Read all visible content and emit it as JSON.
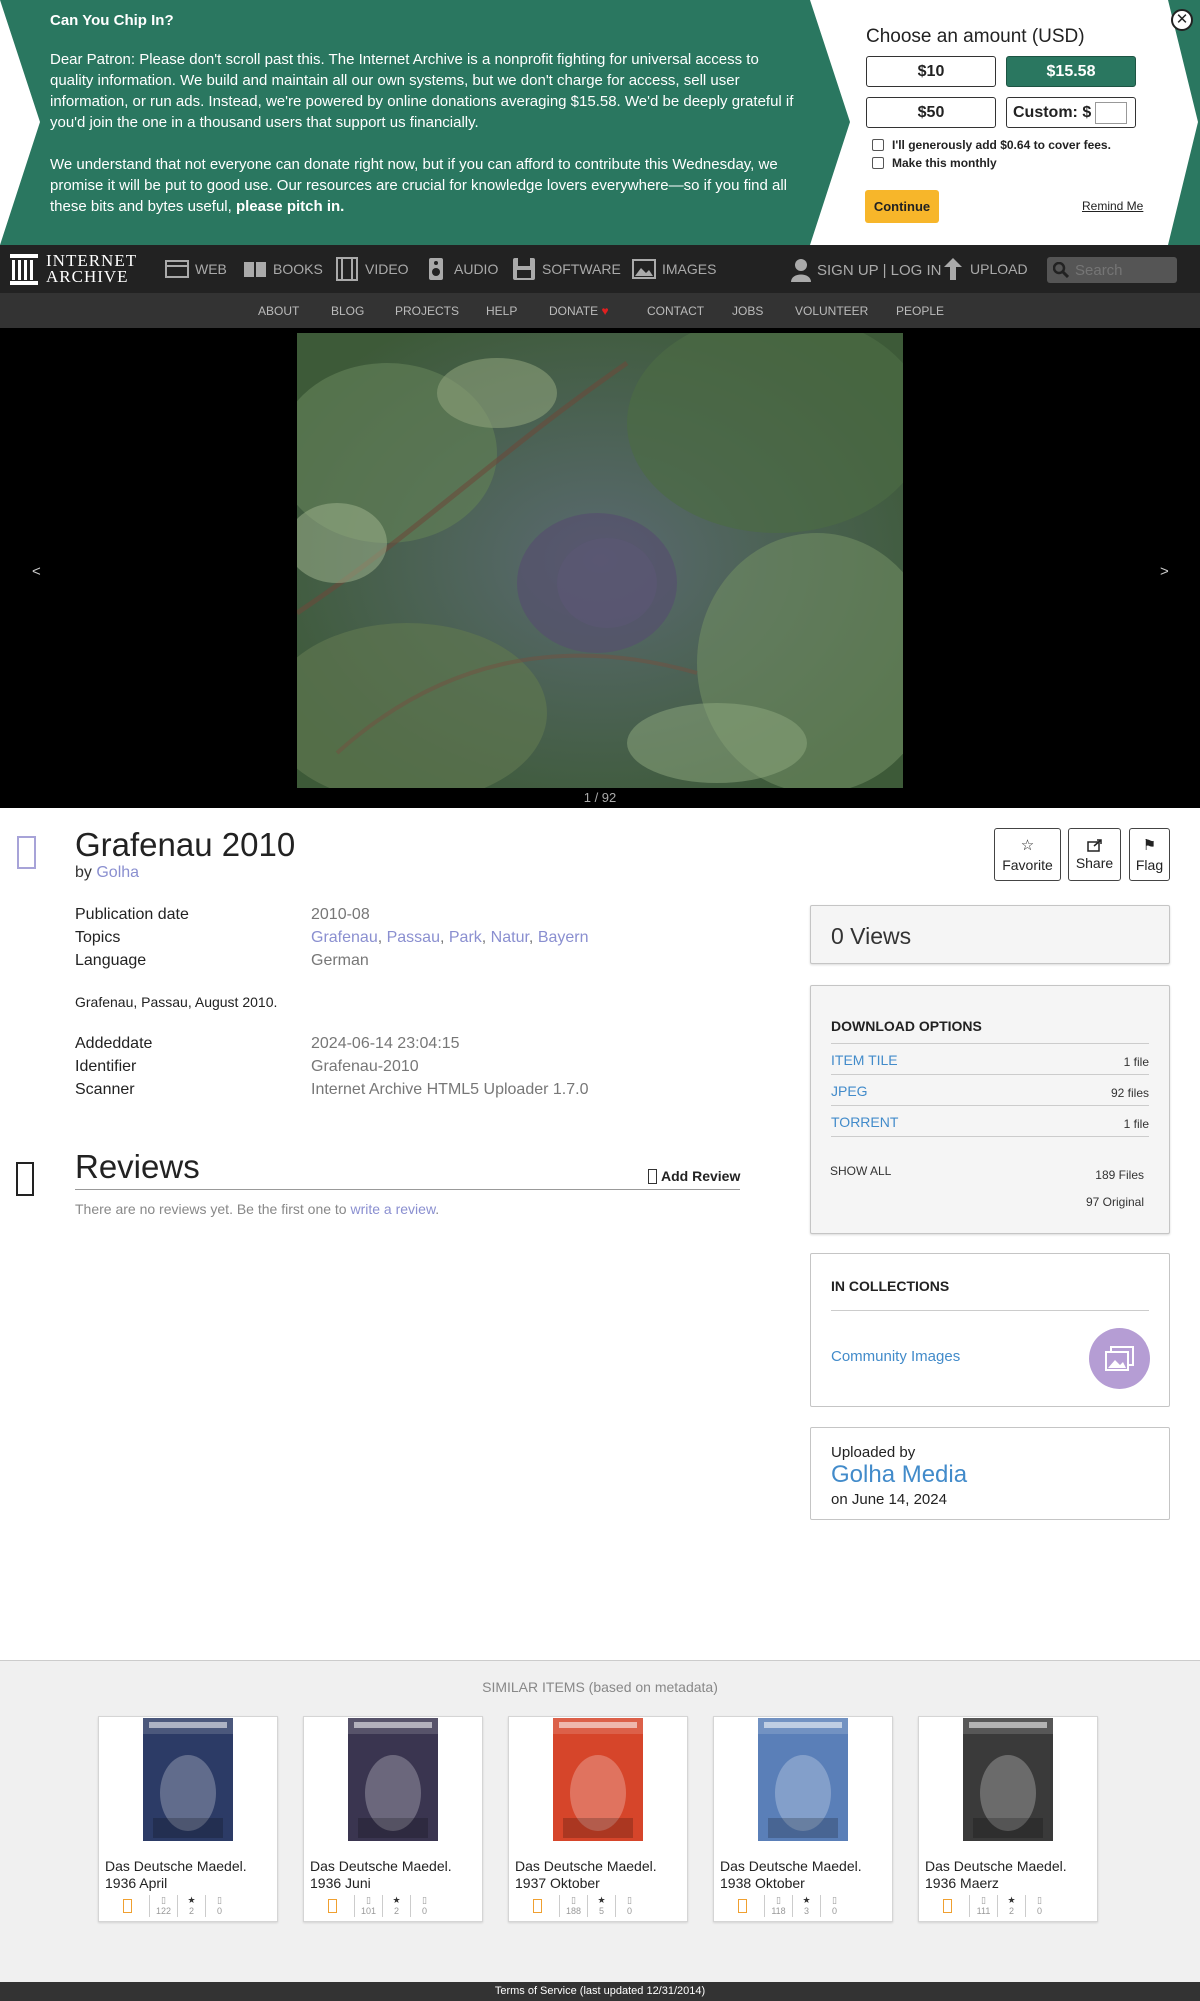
{
  "banner": {
    "heading": "Can You Chip In?",
    "paragraph1": "Dear Patron: Please don't scroll past this. The Internet Archive is a nonprofit fighting for universal access to quality information. We build and maintain all our own systems, but we don't charge for access, sell user information, or run ads. Instead, we're powered by online donations averaging $15.58. We'd be deeply grateful if you'd join the one in a thousand users that support us financially.",
    "paragraph2": "We understand that not everyone can donate right now, but if you can afford to contribute this Wednesday, we promise it will be put to good use. Our resources are crucial for knowledge lovers everywhere—so if you find all these bits and bytes useful,",
    "paragraph2_bold": "please pitch in.",
    "form_title": "Choose an amount (USD)",
    "amounts": [
      "$10",
      "$15.58",
      "$50"
    ],
    "custom_label": "Custom: $",
    "fee_checkbox": "I'll generously add $0.64 to cover fees.",
    "monthly_checkbox": "Make this monthly",
    "continue": "Continue",
    "remind": "Remind Me",
    "close": "✕",
    "brand_color": "#2a7760"
  },
  "topnav": {
    "logo_line1": "INTERNET",
    "logo_line2": "ARCHIVE",
    "media": [
      "WEB",
      "BOOKS",
      "VIDEO",
      "AUDIO",
      "SOFTWARE",
      "IMAGES"
    ],
    "signup": "SIGN UP | LOG IN",
    "upload": "UPLOAD",
    "search_placeholder": "Search"
  },
  "subnav": [
    "ABOUT",
    "BLOG",
    "PROJECTS",
    "HELP",
    "DONATE",
    "CONTACT",
    "JOBS",
    "VOLUNTEER",
    "PEOPLE"
  ],
  "viewer": {
    "prev": "<",
    "next": ">",
    "counter": "1 / 92"
  },
  "item": {
    "title": "Grafenau 2010",
    "by_label": "by",
    "creator": "Golha",
    "actions": {
      "favorite": "Favorite",
      "share": "Share",
      "flag": "Flag"
    },
    "metadata": {
      "pubdate_label": "Publication date",
      "pubdate": "2010-08",
      "topics_label": "Topics",
      "topics": [
        "Grafenau",
        "Passau",
        "Park",
        "Natur",
        "Bayern"
      ],
      "language_label": "Language",
      "language": "German",
      "description": "Grafenau, Passau, August 2010.",
      "addeddate_label": "Addeddate",
      "addeddate": "2024-06-14 23:04:15",
      "identifier_label": "Identifier",
      "identifier": "Grafenau-2010",
      "scanner_label": "Scanner",
      "scanner": "Internet Archive HTML5 Uploader 1.7.0"
    }
  },
  "reviews": {
    "title": "Reviews",
    "add": "Add Review",
    "empty_text": "There are no reviews yet. Be the first one to",
    "empty_link": "write a review",
    "empty_end": "."
  },
  "sidebar": {
    "views": "0 Views",
    "download_title": "DOWNLOAD OPTIONS",
    "downloads": [
      {
        "name": "ITEM TILE",
        "count": "1 file"
      },
      {
        "name": "JPEG",
        "count": "92 files"
      },
      {
        "name": "TORRENT",
        "count": "1 file"
      }
    ],
    "show_all": "SHOW ALL",
    "total_files": "189 Files",
    "original_files": "97 Original",
    "collections_title": "IN COLLECTIONS",
    "collection": "Community Images",
    "uploaded_by_label": "Uploaded by",
    "uploader": "Golha Media",
    "upload_date": "on June 14, 2024"
  },
  "similar": {
    "title": "SIMILAR ITEMS (based on metadata)",
    "items": [
      {
        "title": "Das Deutsche Maedel. 1936 April",
        "views": "122",
        "favs": "2",
        "reviews": "0",
        "cover_color": "#2c3b66"
      },
      {
        "title": "Das Deutsche Maedel. 1936 Juni",
        "views": "101",
        "favs": "2",
        "reviews": "0",
        "cover_color": "#3a3550"
      },
      {
        "title": "Das Deutsche Maedel. 1937 Oktober",
        "views": "188",
        "favs": "5",
        "reviews": "0",
        "cover_color": "#d6452a"
      },
      {
        "title": "Das Deutsche Maedel. 1938 Oktober",
        "views": "118",
        "favs": "3",
        "reviews": "0",
        "cover_color": "#5a7fb8"
      },
      {
        "title": "Das Deutsche Maedel. 1936 Maerz",
        "views": "111",
        "favs": "2",
        "reviews": "0",
        "cover_color": "#3a3a3a"
      }
    ]
  },
  "footer": "Terms of Service (last updated 12/31/2014)"
}
